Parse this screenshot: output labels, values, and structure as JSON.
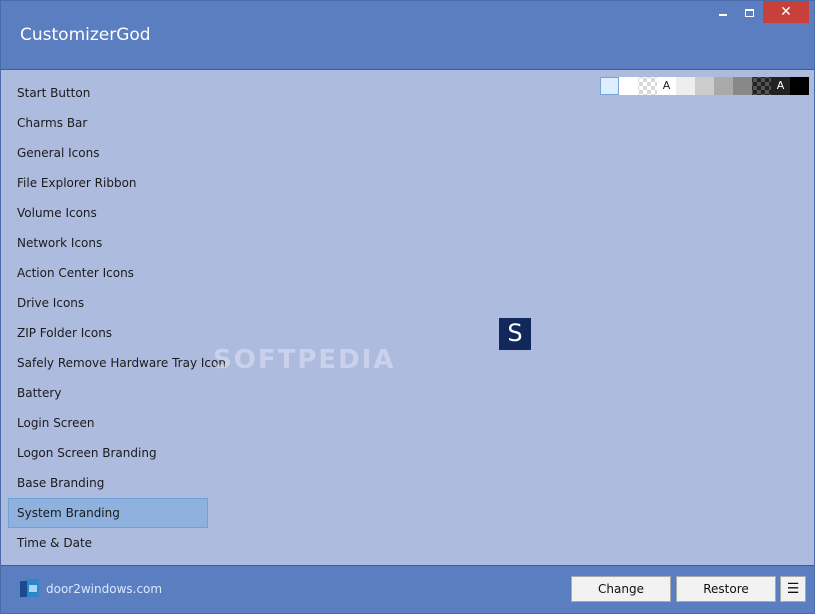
{
  "window": {
    "title": "CustomizerGod",
    "minimize_glyph": "",
    "close_glyph": "✕"
  },
  "sidebar": {
    "items": [
      {
        "label": "Start Button"
      },
      {
        "label": "Charms Bar"
      },
      {
        "label": "General Icons"
      },
      {
        "label": "File Explorer Ribbon"
      },
      {
        "label": "Volume Icons"
      },
      {
        "label": "Network Icons"
      },
      {
        "label": "Action Center Icons"
      },
      {
        "label": "Drive Icons"
      },
      {
        "label": "ZIP Folder Icons"
      },
      {
        "label": "Safely Remove Hardware Tray Icon"
      },
      {
        "label": "Battery"
      },
      {
        "label": "Login Screen"
      },
      {
        "label": "Logon Screen Branding"
      },
      {
        "label": "Base Branding"
      },
      {
        "label": "System Branding"
      },
      {
        "label": "Time & Date"
      }
    ],
    "selected_index": 14
  },
  "swatches": {
    "items": [
      {
        "color": "#ddeeff",
        "kind": "solid"
      },
      {
        "color": "#ffffff",
        "kind": "solid"
      },
      {
        "color": "#ffffff",
        "kind": "checker-light"
      },
      {
        "color": "#ffffff",
        "kind": "letter",
        "text": "A"
      },
      {
        "color": "#eeeeee",
        "kind": "solid"
      },
      {
        "color": "#cccccc",
        "kind": "solid"
      },
      {
        "color": "#aaaaaa",
        "kind": "solid"
      },
      {
        "color": "#888888",
        "kind": "solid"
      },
      {
        "color": "#444444",
        "kind": "checker-dark"
      },
      {
        "color": "#222222",
        "kind": "letter",
        "text": "A"
      },
      {
        "color": "#000000",
        "kind": "solid"
      }
    ],
    "selected_index": 0
  },
  "preview": {
    "glyph": "S",
    "bg_color": "#10285a"
  },
  "watermark": "SOFTPEDIA",
  "footer": {
    "brand_text": "door2windows.com",
    "change_label": "Change",
    "restore_label": "Restore",
    "menu_glyph": "☰"
  },
  "colors": {
    "title_bar": "#5a7ec0",
    "content_bg": "#adbbdf",
    "selection": "#8fb1dd",
    "close_button": "#c7403a"
  }
}
